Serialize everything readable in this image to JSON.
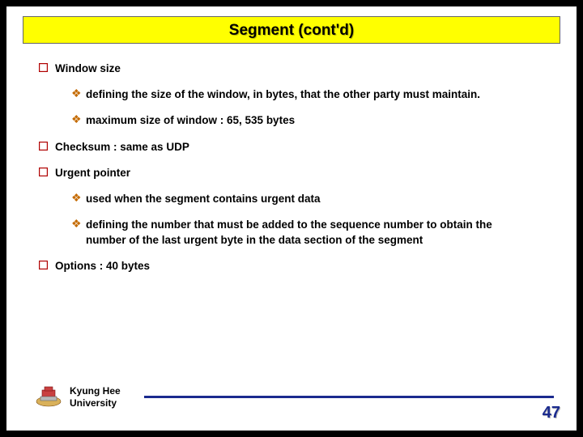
{
  "title": "Segment (cont'd)",
  "items": [
    {
      "label": "Window size",
      "sub": [
        {
          "text": "defining the size of the window, in bytes, that the other party must maintain."
        },
        {
          "text": "maximum size of window : 65, 535 bytes"
        }
      ]
    },
    {
      "label": "Checksum : same as UDP",
      "sub": []
    },
    {
      "label": "Urgent pointer",
      "sub": [
        {
          "text": "used when the segment contains urgent data"
        },
        {
          "text": "defining the number that must be added to the sequence number to obtain the number of the last urgent byte in the data section of the segment"
        }
      ]
    },
    {
      "label": "Options : 40 bytes",
      "sub": []
    }
  ],
  "footer": {
    "university_line1": "Kyung Hee",
    "university_line2": "University",
    "page_number": "47"
  }
}
